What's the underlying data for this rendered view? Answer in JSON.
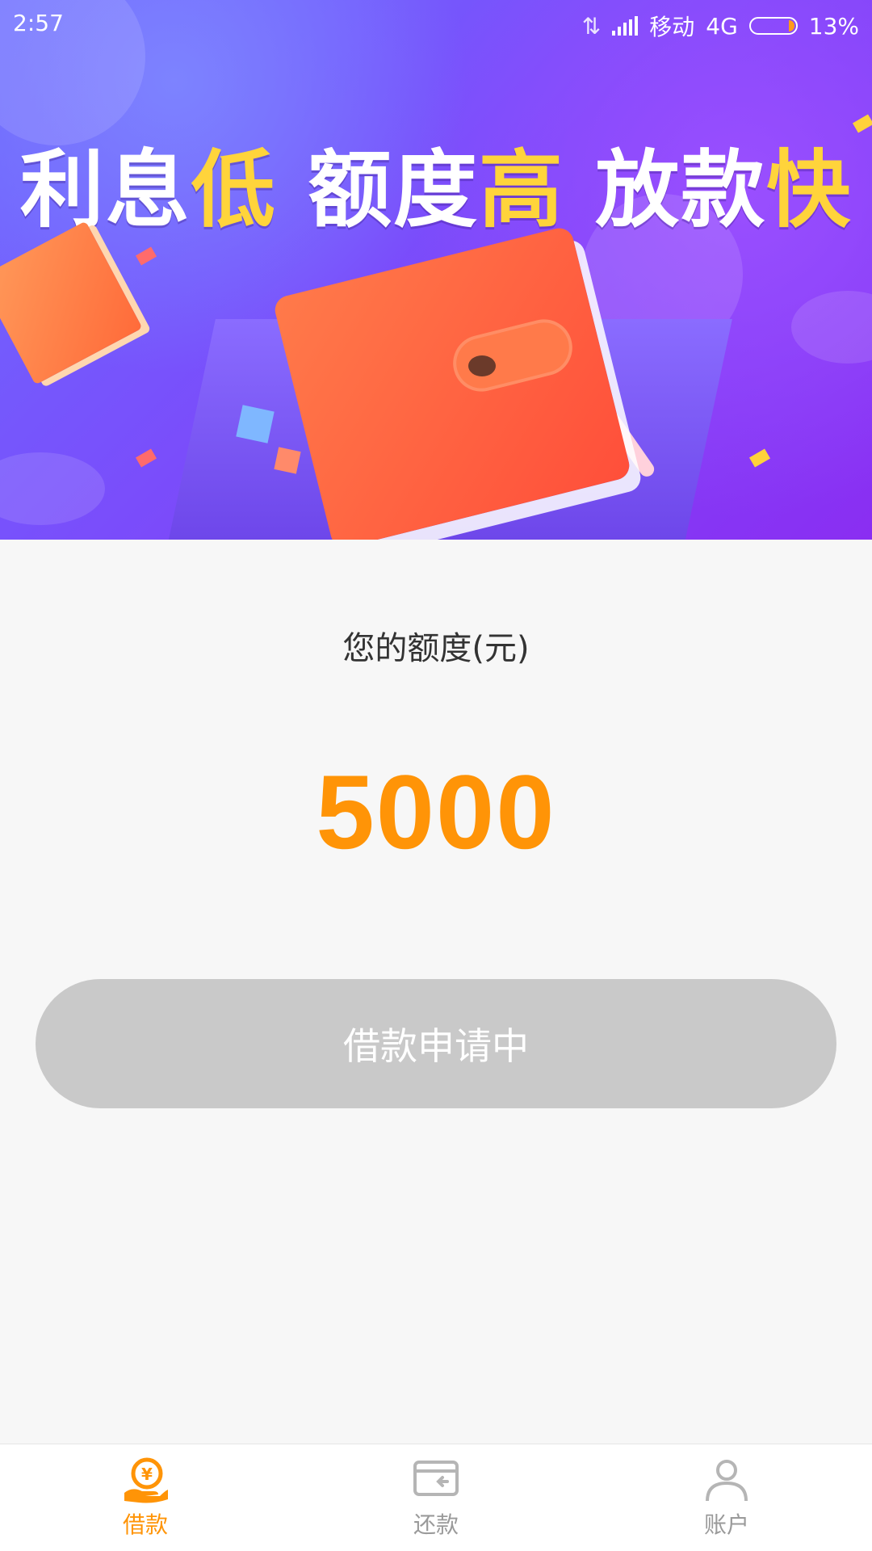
{
  "status_bar": {
    "time": "2:57",
    "carrier": "移动",
    "network": "4G",
    "battery": "13%"
  },
  "banner": {
    "headline_parts": [
      {
        "text": "利息",
        "highlight": false
      },
      {
        "text": "低",
        "highlight": true
      },
      {
        "text": " 额度",
        "highlight": false
      },
      {
        "text": "高",
        "highlight": true
      },
      {
        "text": " 放款",
        "highlight": false
      },
      {
        "text": "快",
        "highlight": true
      }
    ],
    "colors": {
      "text": "#ffffff",
      "highlight": "#ffd43b"
    }
  },
  "credit": {
    "label": "您的额度(元)",
    "amount": "5000",
    "amount_color": "#ff9407"
  },
  "primary_action": {
    "label": "借款申请中",
    "state": "disabled"
  },
  "tabbar": {
    "items": [
      {
        "label": "借款",
        "icon": "loan-coin-hand-icon",
        "active": true
      },
      {
        "label": "还款",
        "icon": "repay-card-icon",
        "active": false
      },
      {
        "label": "账户",
        "icon": "account-person-icon",
        "active": false
      }
    ],
    "active_color": "#ff9407",
    "inactive_color": "#9a9a9a"
  }
}
